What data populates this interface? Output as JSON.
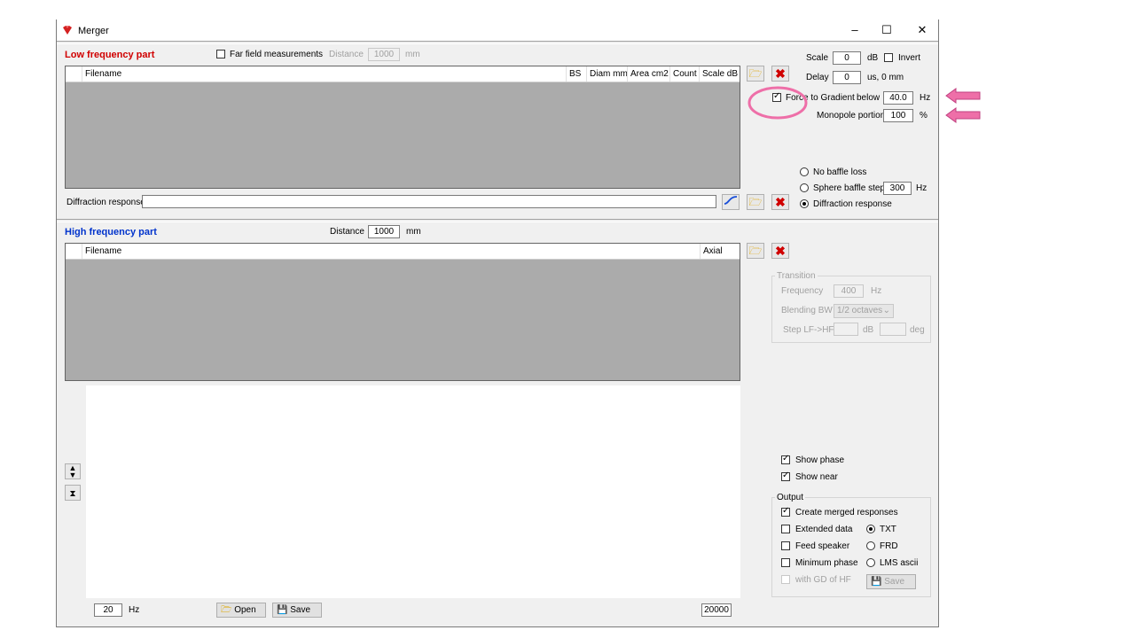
{
  "window": {
    "title": "Merger",
    "minimize": "–",
    "maximize": "☐",
    "close": "✕"
  },
  "low": {
    "title": "Low frequency part",
    "far_field_label": "Far field measurements",
    "distance_label": "Distance",
    "distance_value": "1000",
    "distance_unit": "mm",
    "columns": [
      "Filename",
      "BS",
      "Diam mm",
      "Area cm2",
      "Count",
      "Scale dB"
    ],
    "diffraction_label": "Diffraction response",
    "diffraction_value": ""
  },
  "settings": {
    "scale_label": "Scale",
    "scale_value": "0",
    "scale_unit": "dB",
    "invert_label": "Invert",
    "delay_label": "Delay",
    "delay_value": "0",
    "delay_unit": "us,  0 mm",
    "force_label": "Force to Gradient",
    "below_label": "below",
    "below_value": "40.0",
    "below_unit": "Hz",
    "monopole_label": "Monopole portion",
    "monopole_value": "100",
    "monopole_unit": "%",
    "no_baffle_label": "No baffle loss",
    "sphere_label": "Sphere baffle step",
    "sphere_value": "300",
    "sphere_unit": "Hz",
    "diffraction_opt_label": "Diffraction response"
  },
  "high": {
    "title": "High frequency part",
    "distance_label": "Distance",
    "distance_value": "1000",
    "distance_unit": "mm",
    "columns": [
      "Filename",
      "Axial"
    ]
  },
  "transition": {
    "title": "Transition",
    "frequency_label": "Frequency",
    "frequency_value": "400",
    "frequency_unit": "Hz",
    "blending_label": "Blending BW",
    "blending_value": "1/2 octaves",
    "step_label": "Step LF->HF",
    "step_db_unit": "dB",
    "step_deg_unit": "deg"
  },
  "view": {
    "show_phase": "Show phase",
    "show_near": "Show near"
  },
  "output": {
    "title": "Output",
    "create_merged": "Create merged responses",
    "extended_data": "Extended data",
    "feed_speaker": "Feed speaker",
    "minimum_phase": "Minimum phase",
    "with_gd": "with GD of HF",
    "txt": "TXT",
    "frd": "FRD",
    "lms": "LMS ascii",
    "save": "Save"
  },
  "plot": {
    "fmin": "20",
    "fmin_unit": "Hz",
    "fmax": "20000",
    "open_label": "Open",
    "save_label": "Save"
  },
  "colors": {
    "low_title": "#d00000",
    "high_title": "#0033cc",
    "annotation": "#ee6fa8"
  }
}
